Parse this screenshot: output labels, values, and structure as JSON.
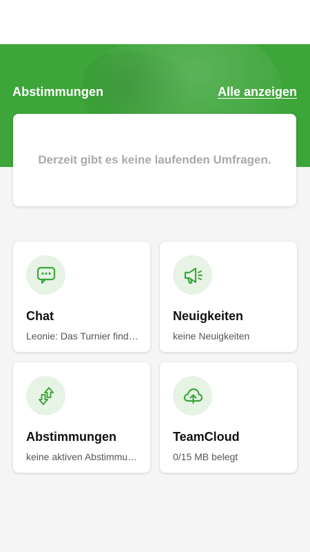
{
  "polls": {
    "title": "Abstimmungen",
    "show_all_label": "Alle anzeigen",
    "empty_message": "Derzeit gibt es keine laufenden Umfragen."
  },
  "tiles": [
    {
      "title": "Chat",
      "subtitle": "Leonie: Das Turnier findet statt",
      "icon": "chat-bubble-icon"
    },
    {
      "title": "Neuigkeiten",
      "subtitle": "keine Neuigkeiten",
      "icon": "megaphone-icon"
    },
    {
      "title": "Abstimmungen",
      "subtitle": "keine aktiven Abstimmungen",
      "icon": "vote-arrows-icon"
    },
    {
      "title": "TeamCloud",
      "subtitle": "0/15 MB belegt",
      "icon": "cloud-upload-icon"
    }
  ],
  "colors": {
    "brand_green": "#3da53a",
    "icon_bg": "#e6f3e5",
    "muted_text": "#a9a9a9"
  }
}
